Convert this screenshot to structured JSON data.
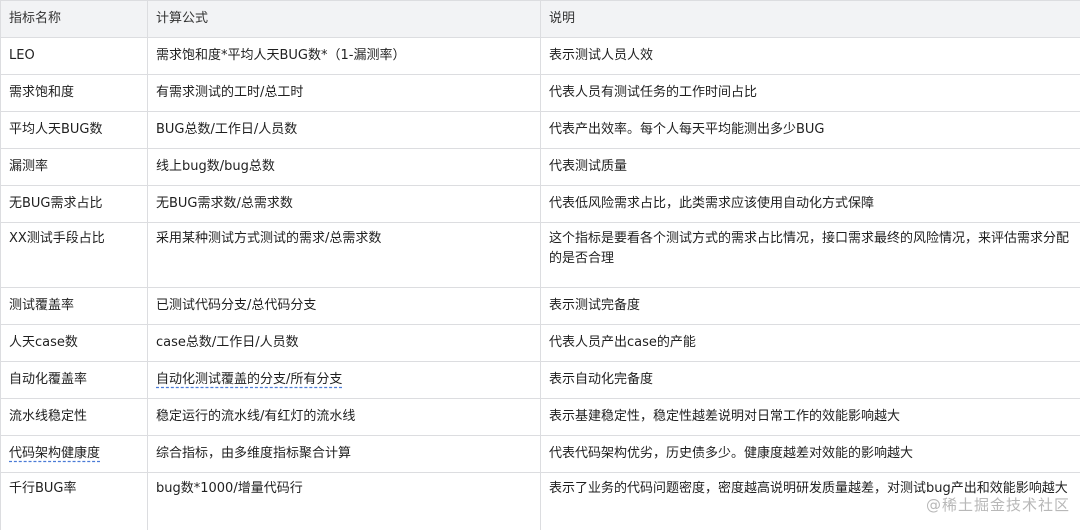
{
  "table": {
    "headers": [
      "指标名称",
      "计算公式",
      "说明"
    ],
    "rows": [
      {
        "name": "LEO",
        "formula": "需求饱和度*平均人天BUG数*（1-漏测率）",
        "desc": "表示测试人员人效"
      },
      {
        "name": "需求饱和度",
        "formula": "有需求测试的工时/总工时",
        "desc": "代表人员有测试任务的工作时间占比"
      },
      {
        "name": "平均人天BUG数",
        "formula": "BUG总数/工作日/人员数",
        "desc": "代表产出效率。每个人每天平均能测出多少BUG"
      },
      {
        "name": "漏测率",
        "formula": "线上bug数/bug总数",
        "desc": "代表测试质量"
      },
      {
        "name": "无BUG需求占比",
        "formula": "无BUG需求数/总需求数",
        "desc": "代表低风险需求占比，此类需求应该使用自动化方式保障"
      },
      {
        "name": "XX测试手段占比",
        "formula": "采用某种测试方式测试的需求/总需求数",
        "desc": "这个指标是要看各个测试方式的需求占比情况，接口需求最终的风险情况，来评估需求分配的是否合理"
      },
      {
        "name": "测试覆盖率",
        "formula": "已测试代码分支/总代码分支",
        "desc": "表示测试完备度"
      },
      {
        "name": "人天case数",
        "formula": "case总数/工作日/人员数",
        "desc": "代表人员产出case的产能"
      },
      {
        "name": "自动化覆盖率",
        "formula": "自动化测试覆盖的分支/所有分支",
        "desc": "表示自动化完备度"
      },
      {
        "name": "流水线稳定性",
        "formula": "稳定运行的流水线/有红灯的流水线",
        "desc": "表示基建稳定性，稳定性越差说明对日常工作的效能影响越大"
      },
      {
        "name": "代码架构健康度",
        "formula": "综合指标，由多维度指标聚合计算",
        "desc": "代表代码架构优劣，历史债多少。健康度越差对效能的影响越大"
      },
      {
        "name": "千行BUG率",
        "formula": "bug数*1000/增量代码行",
        "desc": "表示了业务的代码问题密度，密度越高说明研发质量越差，对测试bug产出和效能影响越大"
      }
    ]
  },
  "watermark": "@稀土掘金技术社区"
}
